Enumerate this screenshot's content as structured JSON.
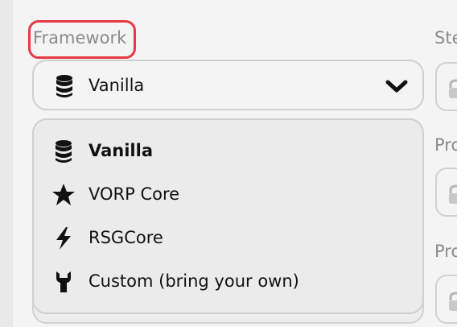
{
  "framework": {
    "label": "Framework",
    "selected": "Vanilla",
    "selected_icon": "database-icon",
    "options": [
      {
        "label": "Vanilla",
        "icon": "database-icon",
        "selected": true
      },
      {
        "label": "VORP Core",
        "icon": "star-icon",
        "selected": false
      },
      {
        "label": "RSGCore",
        "icon": "lightning-icon",
        "selected": false
      },
      {
        "label": "Custom (bring your own)",
        "icon": "wrench-icon",
        "selected": false
      }
    ]
  },
  "side_fields": [
    {
      "label": "Ste"
    },
    {
      "label": "Pro"
    },
    {
      "label": "Pro"
    }
  ],
  "colors": {
    "highlight": "#e53945",
    "border": "#cfcfcf",
    "label": "#8a8a8a",
    "text": "#111111"
  }
}
